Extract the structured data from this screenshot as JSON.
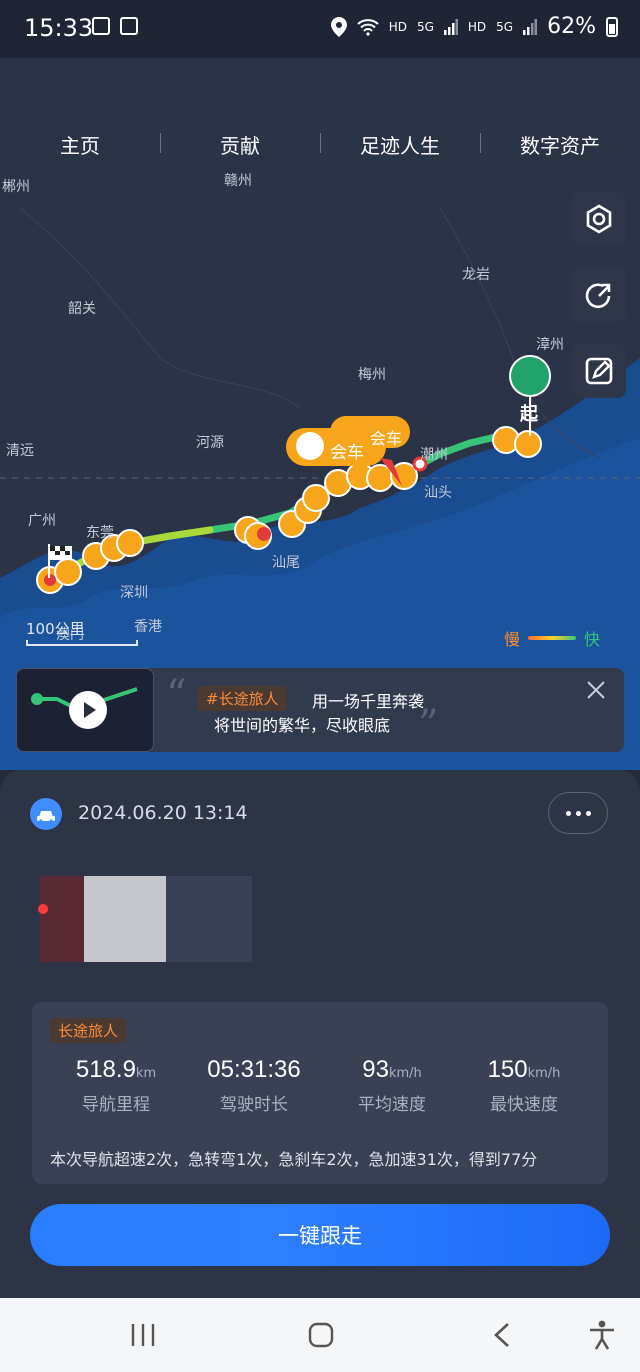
{
  "status": {
    "time": "15:33",
    "battery": "62%",
    "hd1": "HD",
    "hd2": "HD",
    "net1": "5G",
    "net2": "5G"
  },
  "nav": {
    "tabs": [
      "主页",
      "贡献",
      "足迹人生",
      "数字资产"
    ]
  },
  "map": {
    "places": [
      "郴州",
      "赣州",
      "龙岩",
      "韶关",
      "漳州",
      "梅州",
      "清远",
      "河源",
      "潮州",
      "汕头",
      "广州",
      "东莞",
      "汕尾",
      "深圳",
      "香港",
      "澳门"
    ],
    "scale": "100公里",
    "legend_slow": "慢",
    "legend_fast": "快",
    "start_label": "起",
    "meet_label": "会车",
    "colors": {
      "route_fast": "#36c478",
      "route_mid": "#a8d83a",
      "marker": "#f7a51a",
      "start": "#1fa36b",
      "end_dot": "#e23b3b"
    }
  },
  "promo": {
    "tag": "#长途旅人",
    "line1": "用一场千里奔袭",
    "line2": "将世间的繁华，尽收眼底"
  },
  "trip": {
    "date": "2024.06.20 13:14",
    "tag": "长途旅人",
    "stats": [
      {
        "value": "518.9",
        "unit": "km",
        "label": "导航里程"
      },
      {
        "value": "05:31:36",
        "unit": "",
        "label": "驾驶时长"
      },
      {
        "value": "93",
        "unit": "km/h",
        "label": "平均速度"
      },
      {
        "value": "150",
        "unit": "km/h",
        "label": "最快速度"
      }
    ],
    "summary": "本次导航超速2次，急转弯1次，急刹车2次，急加速31次，得到77分",
    "follow_button": "一键跟走"
  }
}
